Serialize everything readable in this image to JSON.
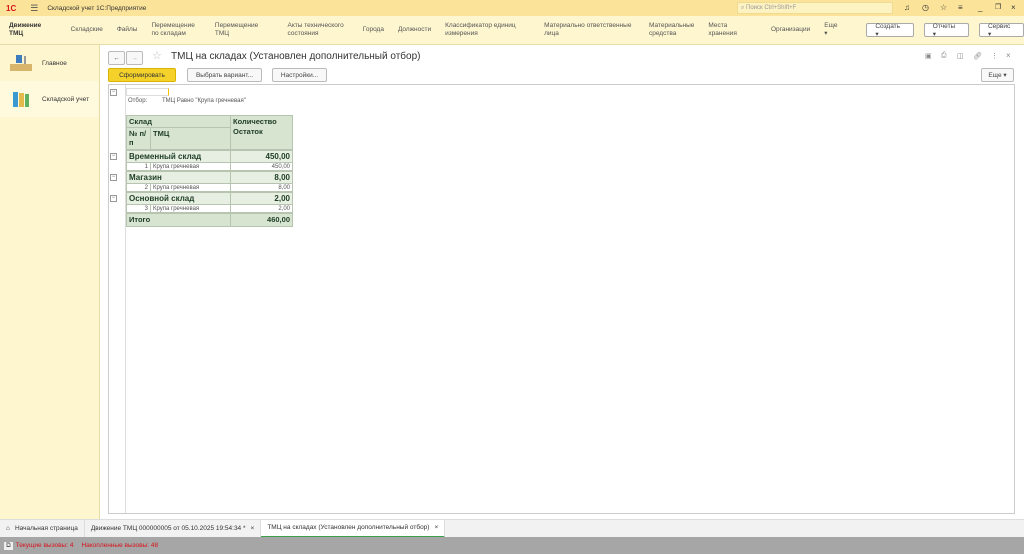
{
  "app": {
    "title": "Складской учет 1С:Предприятие",
    "search_placeholder": "Поиск Ctrl+Shift+F"
  },
  "nav": {
    "items": [
      "Движение ТМЦ",
      "Складские",
      "Файлы",
      "Перемещение по складам",
      "Перемещение ТМЦ",
      "Акты технического состояния",
      "Города",
      "Должности",
      "Классификатор единиц измерения",
      "Материально ответственные лица",
      "Материальные средства",
      "Места хранения",
      "Организации",
      "Еще ▾"
    ],
    "buttons": [
      "Создать ▾",
      "Отчеты ▾",
      "Сервис ▾"
    ]
  },
  "sidebar": {
    "items": [
      {
        "label": "Главное"
      },
      {
        "label": "Складской учет"
      }
    ]
  },
  "form": {
    "title": "ТМЦ на складах (Установлен дополнительный отбор)",
    "generate": "Сформировать",
    "variant": "Выбрать вариант...",
    "settings": "Настройки...",
    "more": "Еще ▾"
  },
  "report": {
    "filter_label": "Отбор:",
    "filter_value": "ТМЦ Равно \"Крупа гречневая\"",
    "headers": {
      "warehouse": "Склад",
      "num": "№ п/п",
      "item": "ТМЦ",
      "qty": "Количество",
      "rest": "Остаток"
    },
    "groups": [
      {
        "name": "Временный склад",
        "total": "450,00",
        "rows": [
          {
            "n": "1",
            "item": "Крупа гречневая",
            "qty": "450,00"
          }
        ]
      },
      {
        "name": "Магазин",
        "total": "8,00",
        "rows": [
          {
            "n": "2",
            "item": "Крупа гречневая",
            "qty": "8,00"
          }
        ]
      },
      {
        "name": "Основной склад",
        "total": "2,00",
        "rows": [
          {
            "n": "3",
            "item": "Крупа гречневая",
            "qty": "2,00"
          }
        ]
      }
    ],
    "total_label": "Итого",
    "total": "460,00"
  },
  "tabs": [
    "Начальная страница",
    "Движение ТМЦ 000000005 от 05.10.2025 19:54:34 *",
    "ТМЦ на складах (Установлен дополнительный отбор)"
  ],
  "status": {
    "current": "Текущие вызовы: 4",
    "accumulated": "Накопленные вызовы: 48"
  }
}
